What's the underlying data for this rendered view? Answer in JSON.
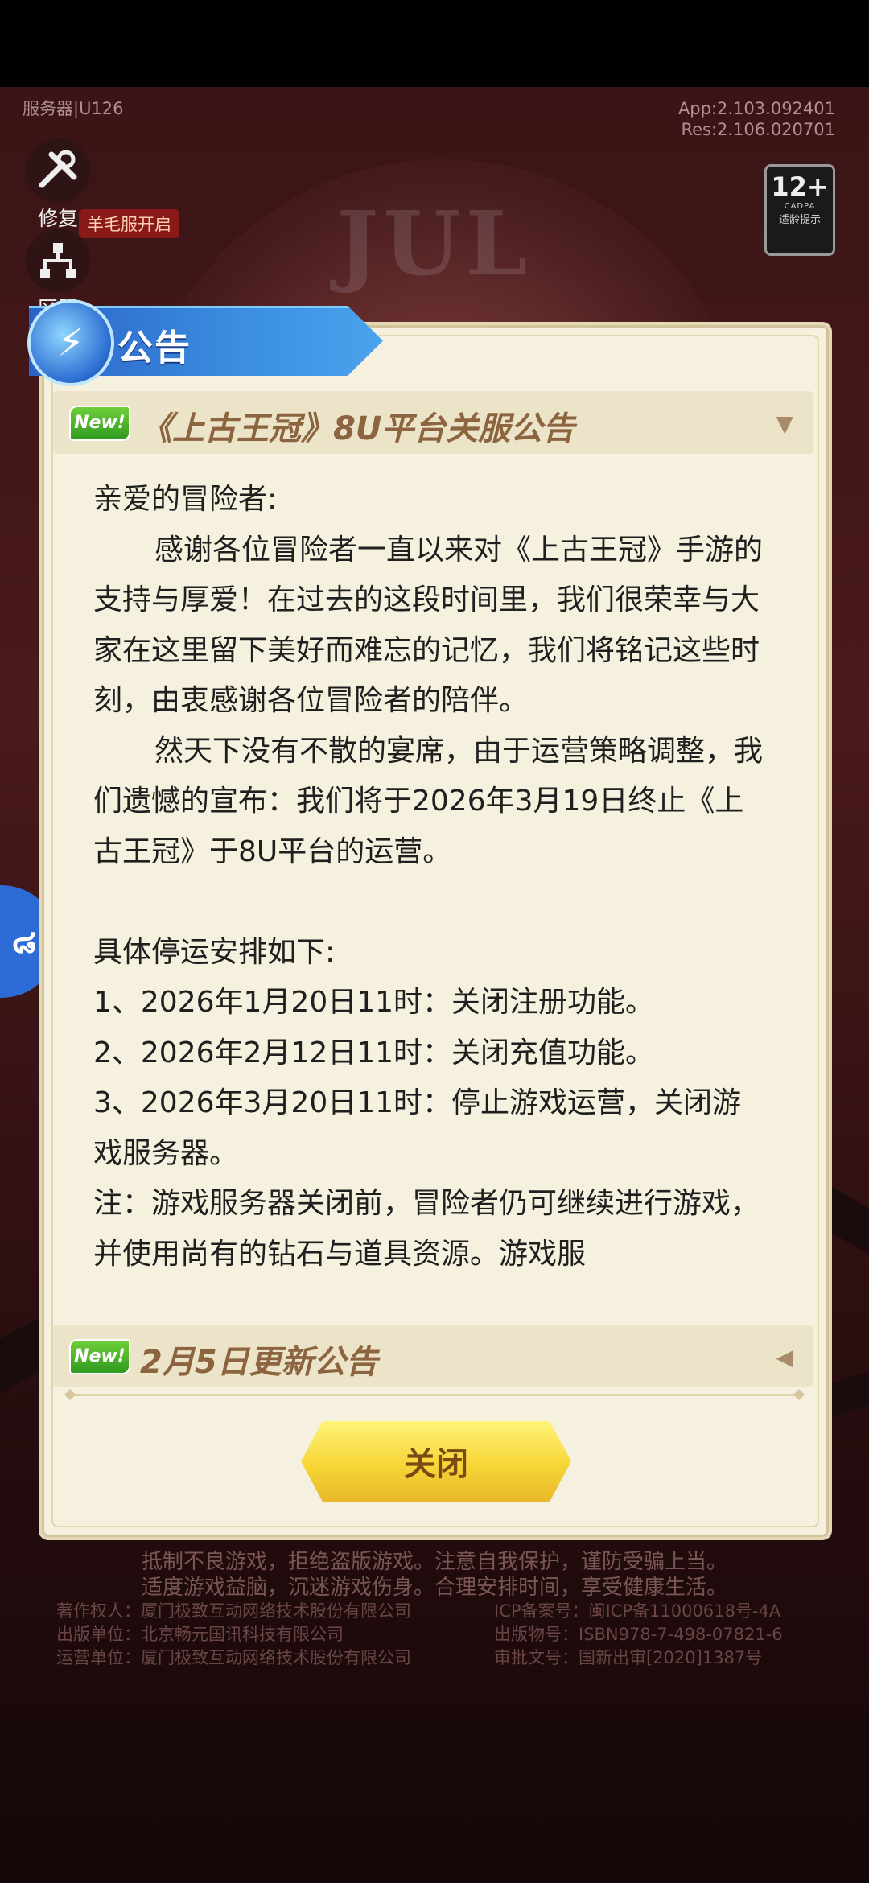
{
  "top": {
    "server": "服务器|U126",
    "app_version": "App:2.103.092401",
    "res_version": "Res:2.106.020701",
    "repair_label": "修复",
    "region_label": "区服",
    "event_badge": "羊毛服开启",
    "age_rating": "12+",
    "age_org": "CADPA",
    "age_tip": "适龄提示"
  },
  "dialog": {
    "title": "公告",
    "new_tag": "New!",
    "announcement_1_title": "《上古王冠》8U平台关服公告",
    "announcement_2_title": "2月5日更新公告",
    "body": [
      "亲爱的冒险者:",
      "感谢各位冒险者一直以来对《上古王冠》手游的支持与厚爱！在过去的这段时间里，我们很荣幸与大家在这里留下美好而难忘的记忆，我们将铭记这些时刻，由衷感谢各位冒险者的陪伴。",
      "然天下没有不散的宴席，由于运营策略调整，我们遗憾的宣布：我们将于2026年3月19日终止《上古王冠》于8U平台的运营。",
      "具体停运安排如下:",
      "1、2026年1月20日11时：关闭注册功能。",
      "2、2026年2月12日11时：关闭充值功能。",
      "3、2026年3月20日11时：停止游戏运营，关闭游戏服务器。",
      "注：游戏服务器关闭前，冒险者仍可继续进行游戏，并使用尚有的钻石与道具资源。游戏服"
    ],
    "close_label": "关闭"
  },
  "footer": {
    "health_line1": "抵制不良游戏，拒绝盗版游戏。注意自我保护，谨防受骗上当。",
    "health_line2": "适度游戏益脑，沉迷游戏伤身。合理安排时间，享受健康生活。",
    "copyright": "著作权人：厦门极致互动网络技术股份有限公司",
    "publisher": "出版单位：北京畅元国讯科技有限公司",
    "operator": "运营单位：厦门极致互动网络技术股份有限公司",
    "icp": "ICP备案号：闽ICP备11000618号-4A",
    "isbn": "出版物号：ISBN978-7-498-07821-6",
    "approval": "审批文号：国新出审[2020]1387号"
  }
}
